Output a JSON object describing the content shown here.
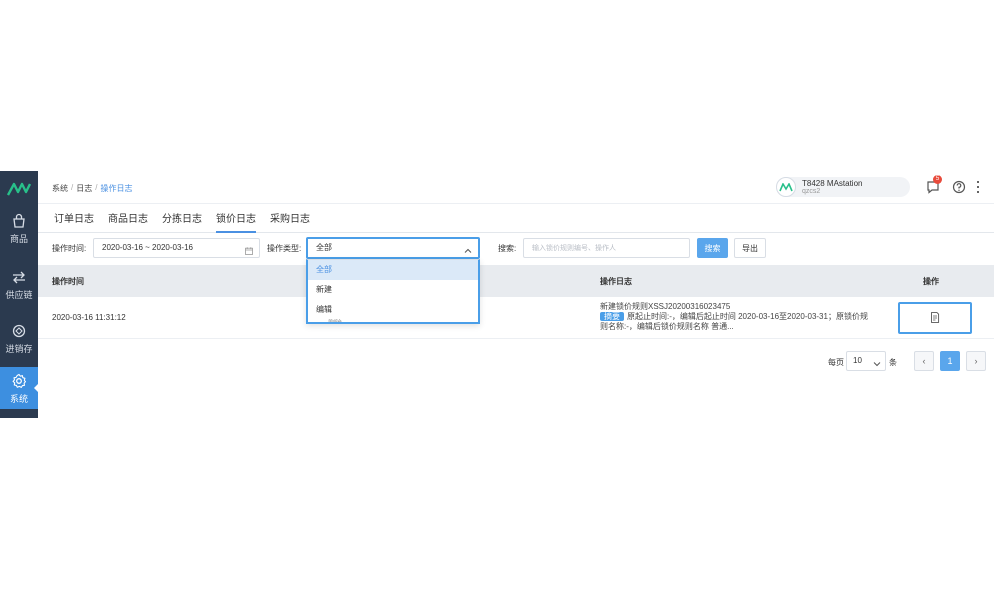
{
  "colors": {
    "sidebar_bg": "#2b3a4f",
    "accent": "#4a9ee8",
    "active_nav": "#3d8fe0",
    "badge": "#e84b3c"
  },
  "sidebar": {
    "logo_icon": "brand-logo-icon",
    "items": [
      {
        "label": "商品",
        "icon": "shopping-bag-icon",
        "active": false
      },
      {
        "label": "供应链",
        "icon": "swap-arrows-icon",
        "active": false
      },
      {
        "label": "进销存",
        "icon": "cycle-box-icon",
        "active": false
      },
      {
        "label": "系统",
        "icon": "gear-icon",
        "active": true
      }
    ]
  },
  "breadcrumb": {
    "items": [
      "系统",
      "日志",
      "操作日志"
    ],
    "separator": "/"
  },
  "user": {
    "avatar_text": "AV",
    "name": "T8428 MAstation",
    "sub": "qzcs2"
  },
  "notifications": {
    "count": "5"
  },
  "tabs": [
    {
      "label": "订单日志",
      "active": false
    },
    {
      "label": "商品日志",
      "active": false
    },
    {
      "label": "分拣日志",
      "active": false
    },
    {
      "label": "锁价日志",
      "active": true
    },
    {
      "label": "采购日志",
      "active": false
    }
  ],
  "filters": {
    "time_label": "操作时间:",
    "date_range": "2020-03-16 ~ 2020-03-16",
    "type_label": "操作类型:",
    "type_value": "全部",
    "type_options": [
      "全部",
      "新建",
      "编辑"
    ],
    "type_ghost_text": "删除",
    "search_label": "搜索:",
    "search_placeholder": "输入锁价规则编号、操作人",
    "search_button": "搜索",
    "export_button": "导出"
  },
  "table": {
    "headers": {
      "time": "操作时间",
      "log": "操作日志",
      "action": "操作"
    },
    "rows": [
      {
        "time": "2020-03-16 11:31:12",
        "log_title": "新建锁价规则XSSJ20200316023475",
        "log_tag": "摘要",
        "log_detail": "原起止时间:-，编辑后起止时间 2020-03-16至2020-03-31；原锁价规则名称:-，编辑后锁价规则名称 普通...",
        "action_icon": "document-detail-icon"
      }
    ]
  },
  "pagination": {
    "per_page_label": "每页",
    "page_size": "10",
    "unit_label": "条",
    "prev": "‹",
    "current": "1",
    "next": "›"
  }
}
